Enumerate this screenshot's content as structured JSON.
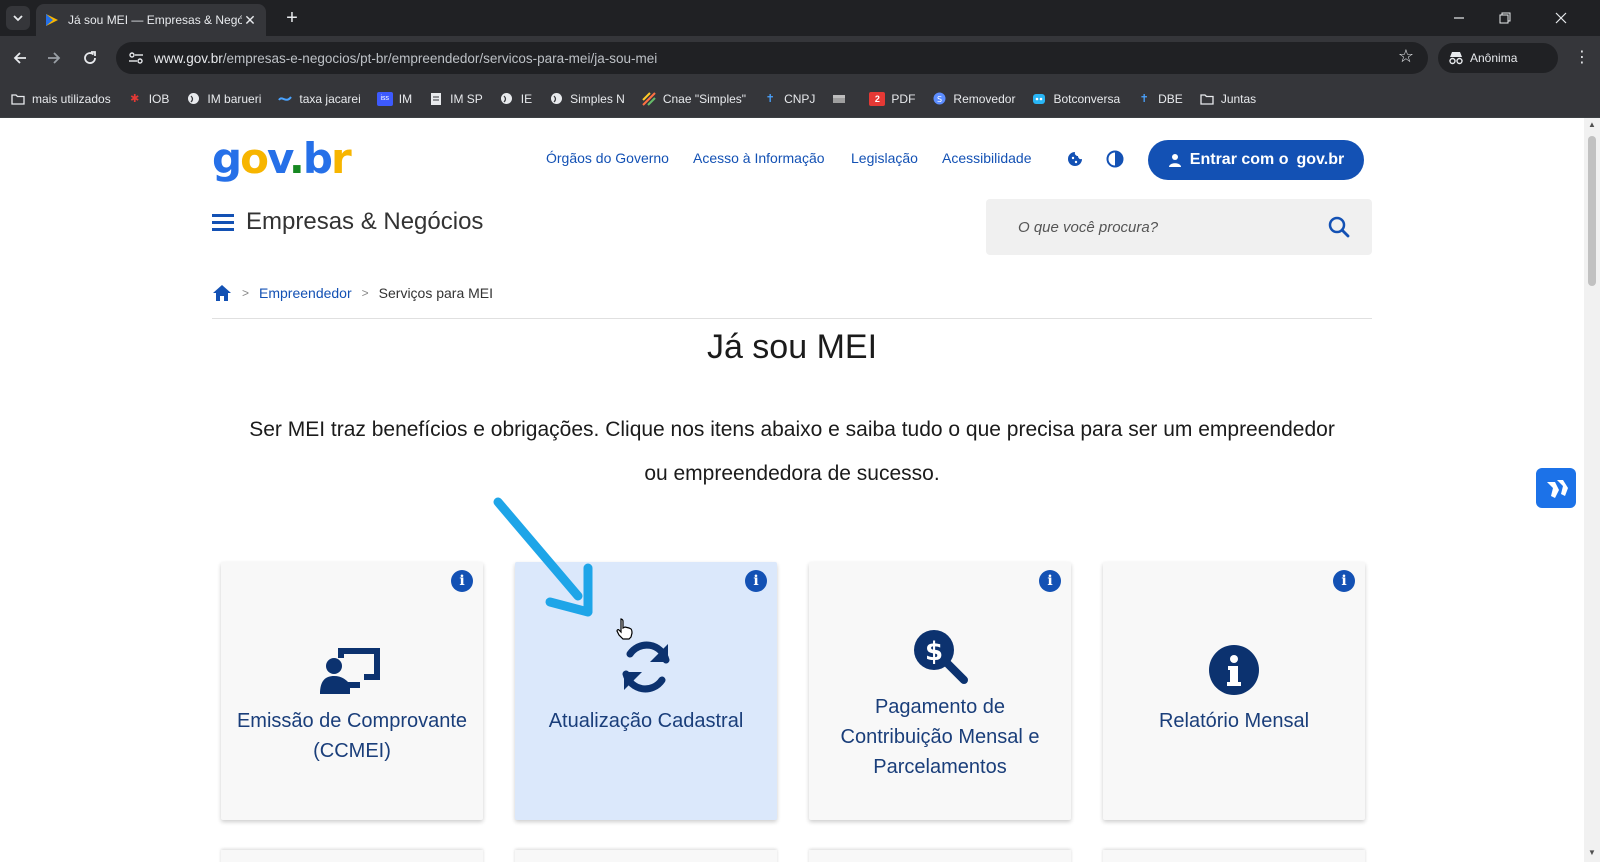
{
  "browser": {
    "tab_title": "Já sou MEI — Empresas & Negó",
    "url_host": "www.gov.br",
    "url_path": "/empresas-e-negocios/pt-br/empreendedor/servicos-para-mei/ja-sou-mei",
    "incognito_label": "Anônima",
    "bookmarks": [
      {
        "label": "mais utilizados",
        "icon": "folder-icon"
      },
      {
        "label": "IOB",
        "icon": "iob-icon"
      },
      {
        "label": "IM barueri",
        "icon": "globe-icon"
      },
      {
        "label": "taxa jacarei",
        "icon": "wave-icon"
      },
      {
        "label": "IM",
        "icon": "iss-icon"
      },
      {
        "label": "IM SP",
        "icon": "doc-icon"
      },
      {
        "label": "IE",
        "icon": "globe-icon"
      },
      {
        "label": "Simples N",
        "icon": "globe-icon"
      },
      {
        "label": "Cnae \"Simples\"",
        "icon": "stripes-icon"
      },
      {
        "label": "CNPJ",
        "icon": "receita-icon"
      },
      {
        "label": "",
        "icon": "flag-icon"
      },
      {
        "label": "PDF",
        "icon": "pdf-icon"
      },
      {
        "label": "Removedor",
        "icon": "removedor-icon"
      },
      {
        "label": "Botconversa",
        "icon": "bot-icon"
      },
      {
        "label": "DBE",
        "icon": "receita-icon"
      },
      {
        "label": "Juntas",
        "icon": "folder-icon"
      }
    ]
  },
  "header": {
    "logo_parts": [
      "g",
      "o",
      "v",
      ".",
      "b",
      "r"
    ],
    "nav": [
      "Órgãos do Governo",
      "Acesso à Informação",
      "Legislação",
      "Acessibilidade"
    ],
    "login_label": "Entrar com o",
    "login_brand": "gov.br",
    "site_title": "Empresas & Negócios",
    "search_placeholder": "O que você procura?"
  },
  "breadcrumb": {
    "items": [
      "Empreendedor",
      "Serviços para MEI"
    ]
  },
  "main": {
    "title": "Já sou MEI",
    "lead": "Ser MEI traz benefícios e obrigações. Clique nos itens abaixo e saiba tudo o que precisa para ser um empreendedor ou empreendedora de sucesso.",
    "cards": [
      {
        "label": "Emissão de Comprovante (CCMEI)",
        "icon": "presentation-icon"
      },
      {
        "label": "Atualização Cadastral",
        "icon": "sync-icon"
      },
      {
        "label": "Pagamento de Contribuição Mensal e Parcelamentos",
        "icon": "dollar-search-icon"
      },
      {
        "label": "Relatório Mensal",
        "icon": "info-circle-icon"
      }
    ]
  },
  "colors": {
    "primary": "#1351b4",
    "card_bg": "#f8f8f8",
    "card_active_bg": "#dbe8fb",
    "annotation_arrow": "#1ea5e8"
  }
}
